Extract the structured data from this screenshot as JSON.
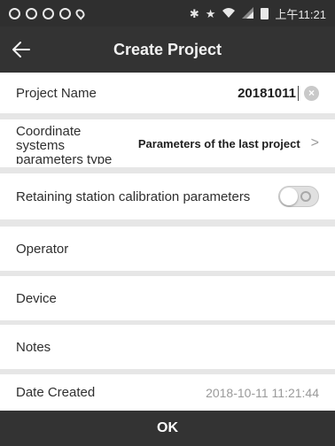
{
  "status_bar": {
    "time": "上午11:21",
    "icons": [
      "app-icon",
      "app-icon",
      "app-icon",
      "app-icon",
      "location-icon",
      "bluetooth-icon",
      "star-icon",
      "wifi-icon",
      "signal-icon",
      "battery-icon"
    ]
  },
  "header": {
    "title": "Create Project",
    "back_icon": "arrow-left-icon"
  },
  "form": {
    "project_name": {
      "label": "Project Name",
      "value": "20181011"
    },
    "coordinate_systems": {
      "label": "Coordinate systems parameters type",
      "value": "Parameters of the last project"
    },
    "retain_calibration": {
      "label": "Retaining station calibration parameters",
      "enabled": false
    },
    "operator": {
      "label": "Operator",
      "value": ""
    },
    "device": {
      "label": "Device",
      "value": ""
    },
    "notes": {
      "label": "Notes",
      "value": ""
    },
    "date_created": {
      "label": "Date Created",
      "value": "2018-10-11 11:21:44"
    }
  },
  "footer": {
    "ok_label": "OK"
  },
  "colors": {
    "bar_background": "#333333",
    "row_background": "#ffffff",
    "separator": "#e6e6e6",
    "muted_text": "#9a9a9a"
  }
}
